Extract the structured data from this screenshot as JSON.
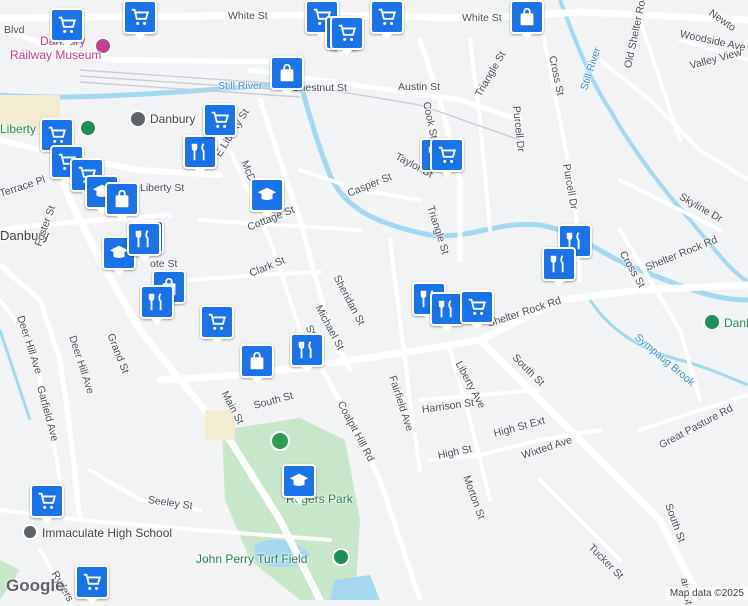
{
  "map": {
    "colors": {
      "water": "#a5d8f0",
      "park": "#c8e6c9",
      "road": "#ffffff",
      "pin": "#1a73e8"
    },
    "labels": {
      "white_st": "White St",
      "blvd": "Blvd",
      "museum_line1": "Danbury",
      "museum_line2": "Railway Museum",
      "still_river_1": "Still River",
      "still_river_2": "Still River",
      "chestnut_st": "Chestnut St",
      "austin_st": "Austin St",
      "cook_st": "Cook St",
      "triangle_st_1": "Triangle St",
      "triangle_st_2": "Triangle St",
      "purcell_dr": "Purcell Dr",
      "purcell_dr_2": "Purcell Dr",
      "cross_st": "Cross St",
      "cross_st_2": "Cross St",
      "newtown": "Newto",
      "old_shelter_rock_rd": "Old Shelter Rock Rd",
      "woodside_ave": "Woodside Ave",
      "valley_view": "Valley View",
      "skyline_dr": "Skyline Dr",
      "shelter_rock_rd_1": "Shelter Rock Rd",
      "shelter_rock_rd_2": "Shelter Rock Rd",
      "sympaug_brook": "Sympaug Brook",
      "danbury_stop": "Danbury",
      "liberty_ice": "Liberty Ice",
      "danbury_city": "Danbury",
      "e_liberty_st": "E Liberty St",
      "mcdonald": "McDo",
      "liberty_st": "Liberty St",
      "terrace_pl": "Terrace Pl",
      "casper_st": "Casper St",
      "taylor_st": "Taylor St",
      "cottage_st": "Cottage St",
      "foster_st": "Foster St",
      "ote_st": "ote St",
      "clark_st": "Clark St",
      "sheridan_st": "Sheridan St",
      "michael_st": "Michael St",
      "stone_st": "Stone",
      "deer_hill_ave_1": "Deer Hill Ave",
      "deer_hill_ave_2": "Deer Hill Ave",
      "grand_st": "Grand St",
      "garfield_ave": "Garfield Ave",
      "main_st": "Main St",
      "south_st_1": "South St",
      "south_st_2": "South St",
      "south_st_3": "South St",
      "coalpit_hill_rd": "Coalpit Hill Rd",
      "fairfield_ave": "Fairfield Ave",
      "liberty_ave": "Liberty Ave",
      "harrison_st": "Harrison St",
      "high_st_ext": "High St Ext",
      "high_st": "High St",
      "wixted_ave": "Wixted Ave",
      "morton_st": "Morton St",
      "great_pasture_rd": "Great Pasture Rd",
      "tucker_st": "Tucker St",
      "seeley_st": "Seeley St",
      "rogers_park": "Rogers Park",
      "immaculate_hs": "Immaculate High School",
      "john_perry": "John Perry Turf Field",
      "ryders": "Ryders",
      "main_st_2": "ain St",
      "danbury_east": "Danl"
    },
    "pins": [
      {
        "icon": "cart-icon"
      },
      {
        "icon": "cart-icon"
      },
      {
        "icon": "cart-icon"
      },
      {
        "icon": "cart-icon"
      },
      {
        "icon": "bag-icon"
      },
      {
        "icon": "restaurant-icon"
      },
      {
        "icon": "cart-icon"
      },
      {
        "icon": "cart-icon"
      },
      {
        "icon": "cart-icon"
      },
      {
        "icon": "school-icon"
      },
      {
        "icon": "bag-icon"
      },
      {
        "icon": "restaurant-icon"
      },
      {
        "icon": "school-icon"
      },
      {
        "icon": "bag-icon"
      },
      {
        "icon": "restaurant-icon"
      },
      {
        "icon": "cart-icon"
      },
      {
        "icon": "restaurant-icon"
      },
      {
        "icon": "cart-icon"
      },
      {
        "icon": "restaurant-icon"
      },
      {
        "icon": "restaurant-icon"
      },
      {
        "icon": "restaurant-icon"
      },
      {
        "icon": "cart-icon"
      },
      {
        "icon": "restaurant-icon"
      },
      {
        "icon": "restaurant-icon"
      },
      {
        "icon": "bag-icon"
      },
      {
        "icon": "restaurant-icon"
      },
      {
        "icon": "restaurant-icon"
      },
      {
        "icon": "bag-icon"
      },
      {
        "icon": "school-icon"
      },
      {
        "icon": "school-icon"
      },
      {
        "icon": "cart-icon"
      },
      {
        "icon": "cart-icon"
      },
      {
        "icon": "cart-icon"
      },
      {
        "icon": "cart-icon"
      }
    ],
    "google": "Google",
    "attribution": "Map data ©2025"
  }
}
